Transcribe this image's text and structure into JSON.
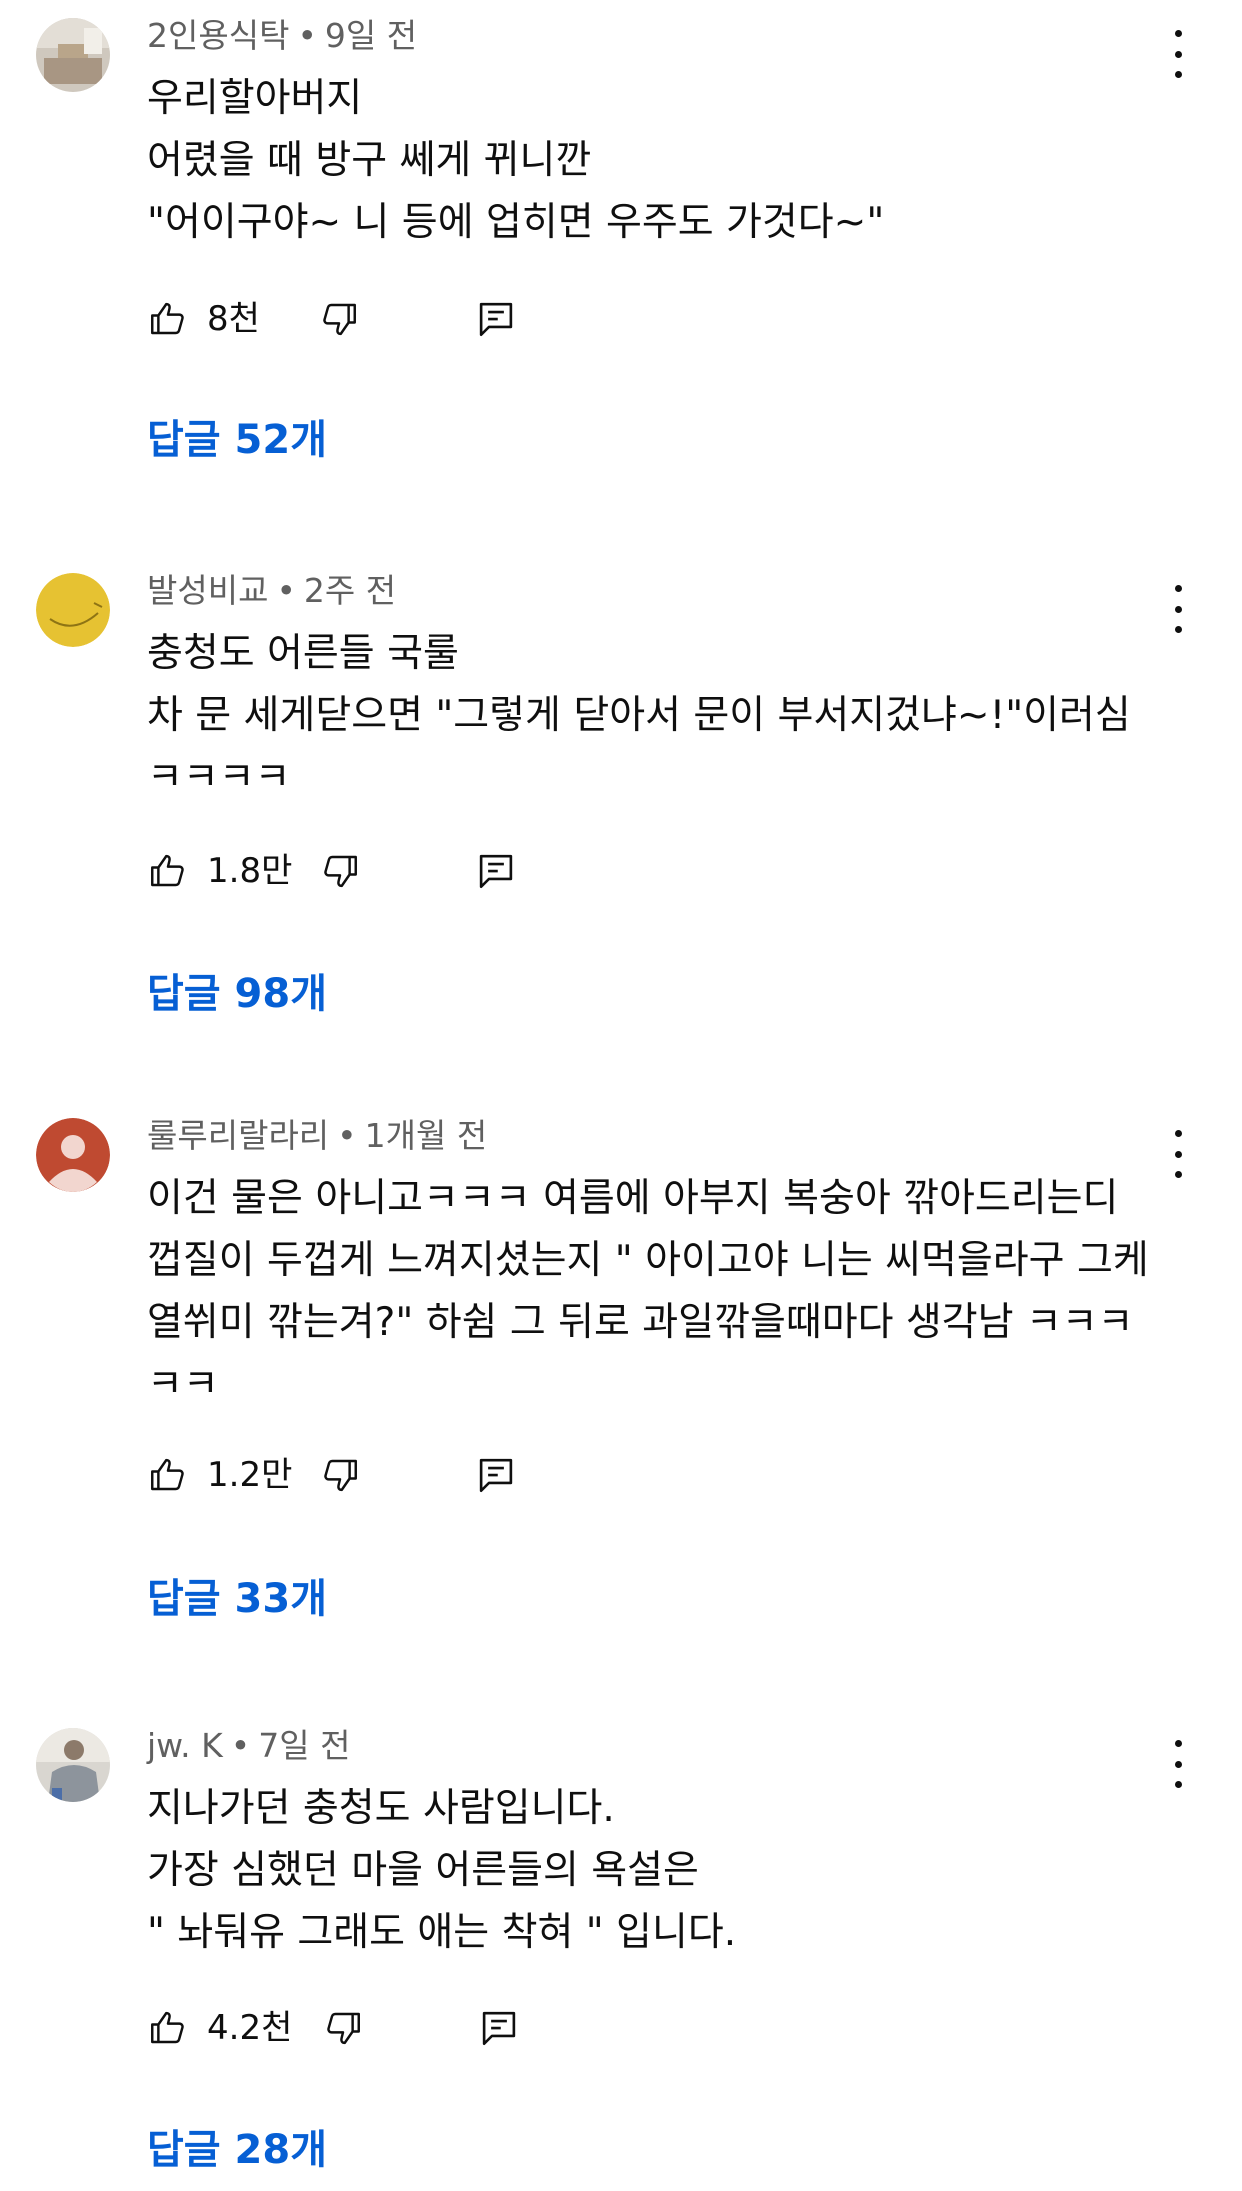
{
  "comments": [
    {
      "author": "2인용식탁",
      "separator": "•",
      "time": "9일 전",
      "lines": [
        "우리할아버지",
        "어렸을 때 방구 쎄게 뀌니깐",
        "\"어이구야~ 니 등에 업히면 우주도 가것다~\""
      ],
      "likes": "8천",
      "replies": "답글 52개",
      "avatar_icon": "room-photo-avatar"
    },
    {
      "author": "발성비교",
      "separator": "•",
      "time": "2주 전",
      "lines": [
        "충청도 어른들 국룰",
        "차 문 세게닫으면 \"그렇게 닫아서 문이 부서지겄냐~!\"이러심",
        "ㅋㅋㅋㅋ"
      ],
      "likes": "1.8만",
      "replies": "답글 98개",
      "avatar_icon": "yellow-face-avatar"
    },
    {
      "author": "룰루리랄라리",
      "separator": "•",
      "time": "1개월 전",
      "lines": [
        "이건 물은 아니고ㅋㅋㅋ 여름에 아부지 복숭아 깎아드리는디",
        "껍질이 두껍게 느껴지셨는지 \" 아이고야 니는 씨먹을라구 그케",
        "열쒸미 깎는겨?\" 하쉼 그 뒤로 과일깎을때마다 생각남 ㅋㅋㅋ",
        "ㅋㅋ"
      ],
      "likes": "1.2만",
      "replies": "답글 33개",
      "avatar_icon": "default-person-avatar",
      "avatar_color": "#bf4a31"
    },
    {
      "author": "jw. K",
      "separator": "•",
      "time": "7일 전",
      "lines": [
        "지나가던 충청도 사람입니다.",
        "가장 심했던 마을 어른들의 욕설은",
        "\" 놔둬유 그래도 애는 착혀 \" 입니다."
      ],
      "likes": "4.2천",
      "replies": "답글 28개",
      "avatar_icon": "person-photo-avatar"
    }
  ],
  "colors": {
    "text": "#0f0f0f",
    "meta": "#606060",
    "link": "#065fd4"
  }
}
